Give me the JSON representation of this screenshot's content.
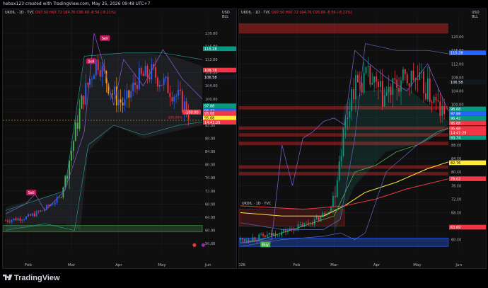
{
  "header": {
    "caption": "hebax123 created with TradingView.com, May 25, 2026 09:48 UTC+7"
  },
  "footer": {
    "brand": "TradingView"
  },
  "chart_data": [
    {
      "type": "candlestick",
      "legend": {
        "symbol": "UKOIL · 1D · TVC",
        "open": "O97.50",
        "high": "H97.72",
        "low": "L94.76",
        "close": "C95.68",
        "change": "-8.56 (-8.21%)"
      },
      "currency": [
        "USD",
        "BLL"
      ],
      "ylim": [
        53,
        123
      ],
      "yticks": [
        56,
        60,
        64,
        68,
        72,
        76,
        80,
        84,
        88,
        92,
        96,
        100,
        104,
        108,
        112,
        116,
        120
      ],
      "xticks": [
        {
          "label": "Feb",
          "t": 0.115
        },
        {
          "label": "Mar",
          "t": 0.335
        },
        {
          "label": "Apr",
          "t": 0.575
        },
        {
          "label": "May",
          "t": 0.795
        },
        {
          "label": "Jun",
          "t": 1.03
        }
      ],
      "price_labels": [
        {
          "text": "115.28",
          "value": 115.28,
          "color": "#089981"
        },
        {
          "text": "108.78",
          "value": 108.78,
          "color": "#f23645"
        },
        {
          "text": "106.58",
          "value": 106.58,
          "color": "#131722"
        },
        {
          "text": "97.88",
          "value": 97.88,
          "color": "#089981"
        },
        {
          "text": "96.42",
          "value": 96.42,
          "color": "#2962ff"
        },
        {
          "text": "95.68",
          "value": 95.68,
          "color": "#f23645"
        },
        {
          "text": "95.68",
          "value": 94.2,
          "color": "#ffeb3b"
        },
        {
          "text": "14:41:29",
          "value": 92.9,
          "color": "#f23645"
        }
      ],
      "annotations": [
        {
          "text": "Sell",
          "t": 0.505,
          "value": 118.5,
          "color": "#c2185b"
        },
        {
          "text": "Sell",
          "t": 0.435,
          "value": 111.5,
          "color": "#c2185b"
        },
        {
          "text": "Sell",
          "t": 0.13,
          "value": 71.5,
          "color": "#c2185b"
        },
        {
          "text": "-100.00",
          "value": 96.0,
          "color": "#f23645",
          "side": "right"
        },
        {
          "text": "-100.00%",
          "value": 94.0,
          "color": "#f23645",
          "t": 0.82
        }
      ],
      "series": [
        {
          "kind": "candles",
          "up_color": "#2962ff",
          "down_color": "#f23645"
        }
      ]
    },
    {
      "type": "candlestick",
      "legend": {
        "symbol": "UKOIL · 1D · TVC",
        "open": "O97.50",
        "high": "H97.72",
        "low": "L94.76",
        "close": "C95.68",
        "change": "-8.56 (-8.21%)"
      },
      "legend2": "UKOIL · 1D · TVC",
      "currency": [
        "USD",
        "BLL"
      ],
      "ylim": [
        57,
        124
      ],
      "yticks": [
        60,
        64,
        68,
        72,
        76,
        80,
        84,
        88,
        92,
        96,
        100,
        104,
        108,
        112,
        116,
        120
      ],
      "xticks": [
        {
          "label": "2026",
          "t": 0.0
        },
        {
          "label": "Feb",
          "t": 0.27
        },
        {
          "label": "Mar",
          "t": 0.45
        },
        {
          "label": "Apr",
          "t": 0.655
        },
        {
          "label": "May",
          "t": 0.85
        },
        {
          "label": "Jun",
          "t": 1.05
        }
      ],
      "price_labels": [
        {
          "text": "115.28",
          "value": 115.28,
          "color": "#2962ff"
        },
        {
          "text": "106.58",
          "value": 106.58,
          "color": "#131722"
        },
        {
          "text": "98.68",
          "value": 98.68,
          "color": "#089981"
        },
        {
          "text": "97.88",
          "value": 97.3,
          "color": "#2962ff"
        },
        {
          "text": "96.42",
          "value": 95.9,
          "color": "#089981"
        },
        {
          "text": "95.68",
          "value": 94.5,
          "color": "#f23645"
        },
        {
          "text": "95.68",
          "value": 92.9,
          "color": "#f23645"
        },
        {
          "text": "14:41:29",
          "value": 91.6,
          "color": "#f23645"
        },
        {
          "text": "93.74",
          "value": 90.2,
          "color": "#089981"
        },
        {
          "text": "82.76",
          "value": 82.76,
          "color": "#ffeb3b"
        },
        {
          "text": "78.02",
          "value": 78.02,
          "color": "#f23645"
        },
        {
          "text": "63.69",
          "value": 63.69,
          "color": "#f23645"
        }
      ],
      "annotations": [
        {
          "text": "Buy",
          "t": 0.12,
          "value": 58.6,
          "color": "#4caf50"
        }
      ],
      "series": [
        {
          "kind": "candles",
          "up_color": "#089981",
          "down_color": "#f23645"
        }
      ]
    }
  ]
}
